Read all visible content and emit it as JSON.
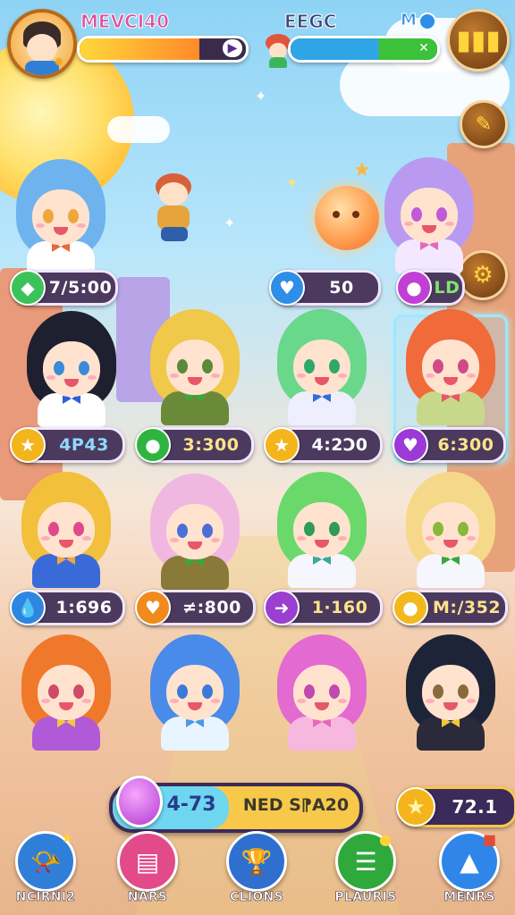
{
  "player": {
    "name": "MEVCI40",
    "progress": 0.72
  },
  "opponent": {
    "name": "EEGC",
    "progress": 0.6,
    "badge": "M"
  },
  "pills": {
    "row1": [
      {
        "value": "7/5:00",
        "icon": "green-gem-icon",
        "color": "#3cc25a"
      },
      {
        "value": "50",
        "icon": "blue-heart-icon",
        "color": "#2e8ee8"
      },
      {
        "value": "LD",
        "icon": "purple-gem-icon",
        "color": "#c23fd6"
      }
    ],
    "row2": [
      {
        "value": "4P43",
        "icon": "star-icon",
        "color": "#f4b41c"
      },
      {
        "value": "3:300",
        "icon": "green-orb-icon",
        "color": "#2fb53f"
      },
      {
        "value": "4:2Ͻ0",
        "icon": "star-icon",
        "color": "#f4b41c"
      },
      {
        "value": "6:300",
        "icon": "purple-heart-icon",
        "color": "#9b3ad6"
      }
    ],
    "row3": [
      {
        "value": "1:696",
        "icon": "blue-drop-icon",
        "color": "#2f86e0"
      },
      {
        "value": "≠:800",
        "icon": "orange-heart-icon",
        "color": "#f08a1c"
      },
      {
        "value": "1·160",
        "icon": "purple-arrow-icon",
        "color": "#9a3fd0"
      },
      {
        "value": "M:/352",
        "icon": "gold-coin-icon",
        "color": "#f2b81e"
      }
    ]
  },
  "bottom": {
    "big_left": "4-73",
    "big_right": "NED S⁋A20",
    "coins": "72.1"
  },
  "nav": [
    {
      "label": "NCIRNI2",
      "icon": "horn-icon",
      "color": "#2f7fd8"
    },
    {
      "label": "NARS",
      "icon": "clipboard-icon",
      "color": "#e34a8a"
    },
    {
      "label": "CLIONS",
      "icon": "trophy-icon",
      "color": "#2f6fd0"
    },
    {
      "label": "PLAURIS",
      "icon": "list-icon",
      "color": "#2fa83c"
    },
    {
      "label": "MENRS",
      "icon": "triangle-icon",
      "color": "#2f86e8"
    }
  ]
}
